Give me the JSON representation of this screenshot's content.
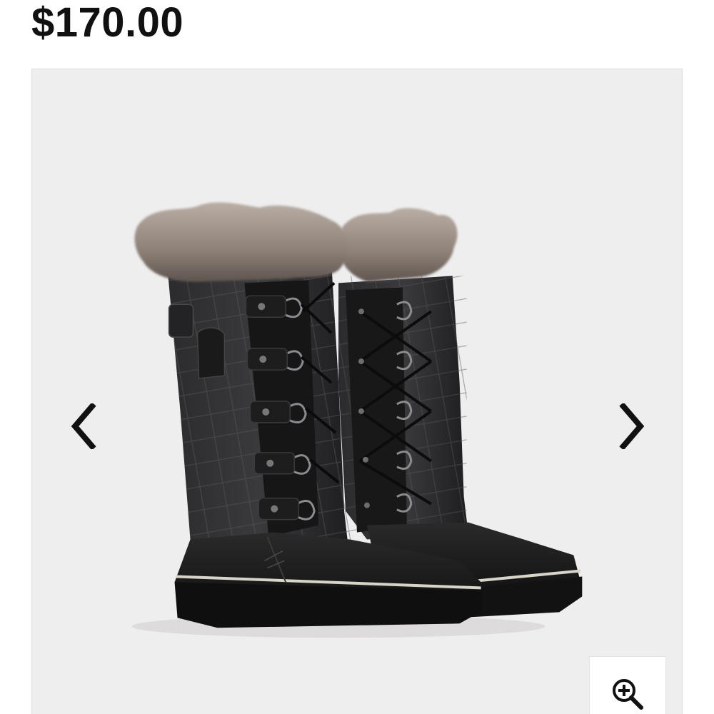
{
  "product": {
    "price": "$170.00"
  },
  "gallery": {
    "image_description": "boot-pair-image",
    "prev_icon": "chevron-left-icon",
    "next_icon": "chevron-right-icon",
    "zoom_icon": "zoom-in-icon",
    "background_color": "#efeeef"
  }
}
